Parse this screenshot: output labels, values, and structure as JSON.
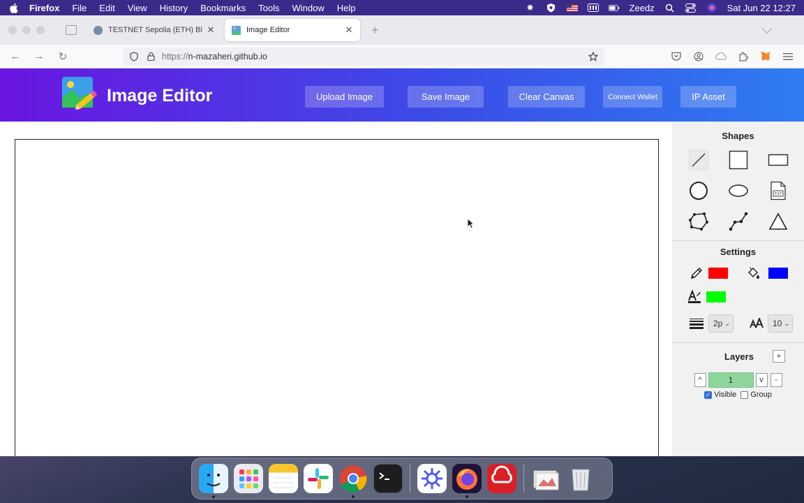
{
  "menubar": {
    "app": "Firefox",
    "items": [
      "File",
      "Edit",
      "View",
      "History",
      "Bookmarks",
      "Tools",
      "Window",
      "Help"
    ],
    "user": "Zeedz",
    "clock": "Sat Jun 22  12:27",
    "status_icons": [
      "brightness-icon",
      "vpn-icon",
      "flag-us-icon",
      "battery-icon",
      "search-icon",
      "control-center-icon",
      "siri-icon"
    ]
  },
  "browser": {
    "tabs": [
      {
        "title": "TESTNET Sepolia (ETH) Blockch",
        "active": false,
        "favicon_color": "#7a8aa8"
      },
      {
        "title": "Image Editor",
        "active": true,
        "favicon_color": "#5aa0e8"
      }
    ],
    "url_prefix": "https://",
    "url_host": "n-mazaheri.github.io"
  },
  "app": {
    "title": "Image Editor",
    "buttons": {
      "upload": "Upload Image",
      "save": "Save Image",
      "clear": "Clear Canvas",
      "wallet": "Connect Wallet",
      "ip": "IP Asset"
    }
  },
  "sidebar": {
    "shapes_title": "Shapes",
    "shapes": [
      "line-tool-icon",
      "square-tool-icon",
      "rectangle-tool-icon",
      "circle-tool-icon",
      "ellipse-tool-icon",
      "text-tool-icon",
      "polygon-tool-icon",
      "polyline-tool-icon",
      "triangle-tool-icon"
    ],
    "settings_title": "Settings",
    "stroke_color": "#ff0000",
    "fill_color": "#0000ff",
    "text_color": "#00ff00",
    "line_width_value": "2p",
    "font_size_value": "10",
    "layers_title": "Layers",
    "add_layer": "+",
    "layer_up": "^",
    "layer_name": "1",
    "layer_down": "v",
    "remove_layer": "-",
    "visible_label": "Visible",
    "visible_checked": true,
    "group_label": "Group",
    "group_checked": false
  },
  "dock": {
    "apps": [
      "Finder",
      "Launchpad",
      "Notes",
      "Slack",
      "Chrome",
      "Terminal",
      "Perplexity",
      "Firefox",
      "Creative Cloud",
      "Downloads",
      "Trash"
    ]
  }
}
